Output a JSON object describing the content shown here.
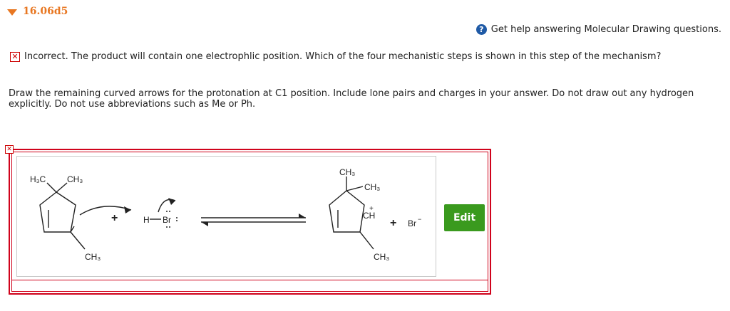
{
  "question": {
    "id": "16.06d5"
  },
  "help": {
    "label": "Get help answering Molecular Drawing questions."
  },
  "feedback": {
    "text": "Incorrect. The product will contain one electrophlic position. Which of the four mechanistic steps is shown in this step of the mechanism?"
  },
  "instructions": {
    "text": "Draw the remaining curved arrows for the protonation at C1 position. Include lone pairs and charges in your answer. Do not draw out any hydrogen explicitly. Do not use abbreviations such as Me or Ph."
  },
  "drawing": {
    "reactant": {
      "label_h3c": "H₃C",
      "label_ch3_top": "CH₃",
      "label_ch3_bottom": "CH₃"
    },
    "plus_1": "+",
    "hbr": {
      "h": "H",
      "br": "Br"
    },
    "product": {
      "label_ch3_top": "CH₃",
      "label_ch3_right": "CH₃",
      "label_ch": "CH",
      "charge": "+",
      "label_ch3_bottom": "CH₃"
    },
    "plus_2": "+",
    "bromide": {
      "label": "Br",
      "charge": "−"
    }
  },
  "edit_button": {
    "label": "Edit"
  },
  "colors": {
    "accent_orange": "#e87722",
    "error_red": "#d0021b",
    "edit_green": "#3a9a1e",
    "help_blue": "#1f5aa6"
  }
}
